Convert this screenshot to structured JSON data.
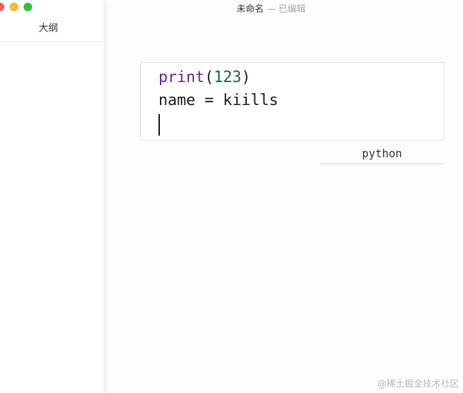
{
  "window": {
    "title": "未命名",
    "separator": "—",
    "status": "已编辑"
  },
  "sidebar": {
    "title": "大纲"
  },
  "editor": {
    "code_block": {
      "language": "python",
      "lines": [
        [
          {
            "text": "print",
            "kind": "builtin"
          },
          {
            "text": "(",
            "kind": "plain"
          },
          {
            "text": "123",
            "kind": "number"
          },
          {
            "text": ")",
            "kind": "plain"
          }
        ],
        [
          {
            "text": "name = kiills",
            "kind": "plain"
          }
        ]
      ]
    }
  },
  "watermark": "@稀土掘金技术社区",
  "colors": {
    "builtin": "#6a1fa3",
    "number": "#116644",
    "close": "#fe5f57",
    "minimize": "#febc2e",
    "maximize": "#28c840"
  }
}
